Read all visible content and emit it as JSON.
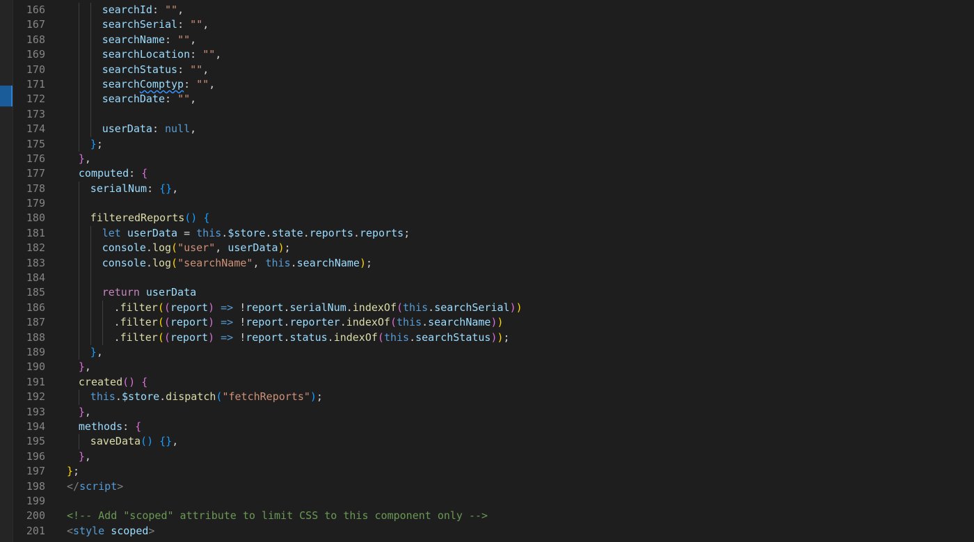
{
  "editor": {
    "colors": {
      "background": "#1e1e1e",
      "line_number": "#858585",
      "active_marker": "#1a5b99"
    },
    "lines": [
      {
        "num": "166",
        "guides": [
          1,
          2
        ],
        "tokens": [
          [
            "searchId",
            "prop"
          ],
          [
            ": ",
            ""
          ],
          [
            "\"\"",
            "str"
          ],
          [
            ",",
            ""
          ]
        ]
      },
      {
        "num": "167",
        "guides": [
          1,
          2
        ],
        "tokens": [
          [
            "searchSerial",
            "prop"
          ],
          [
            ": ",
            ""
          ],
          [
            "\"\"",
            "str"
          ],
          [
            ",",
            ""
          ]
        ]
      },
      {
        "num": "168",
        "guides": [
          1,
          2
        ],
        "tokens": [
          [
            "searchName",
            "prop"
          ],
          [
            ": ",
            ""
          ],
          [
            "\"\"",
            "str"
          ],
          [
            ",",
            ""
          ]
        ]
      },
      {
        "num": "169",
        "guides": [
          1,
          2
        ],
        "tokens": [
          [
            "searchLocation",
            "prop"
          ],
          [
            ": ",
            ""
          ],
          [
            "\"\"",
            "str"
          ],
          [
            ",",
            ""
          ]
        ]
      },
      {
        "num": "170",
        "guides": [
          1,
          2
        ],
        "tokens": [
          [
            "searchStatus",
            "prop"
          ],
          [
            ": ",
            ""
          ],
          [
            "\"\"",
            "str"
          ],
          [
            ",",
            ""
          ]
        ]
      },
      {
        "num": "171",
        "guides": [
          1,
          2
        ],
        "tokens": [
          [
            "search",
            "prop"
          ],
          [
            "Comptyp",
            "prop squiggle"
          ],
          [
            ": ",
            ""
          ],
          [
            "\"\"",
            "str"
          ],
          [
            ",",
            ""
          ]
        ]
      },
      {
        "num": "172",
        "guides": [
          1,
          2
        ],
        "tokens": [
          [
            "searchDate",
            "prop"
          ],
          [
            ": ",
            ""
          ],
          [
            "\"\"",
            "str"
          ],
          [
            ",",
            ""
          ]
        ]
      },
      {
        "num": "173",
        "guides": [
          1,
          2
        ],
        "tokens": []
      },
      {
        "num": "174",
        "guides": [
          1,
          2
        ],
        "tokens": [
          [
            "userData",
            "prop"
          ],
          [
            ": ",
            ""
          ],
          [
            "null",
            "kw"
          ],
          [
            ",",
            ""
          ]
        ]
      },
      {
        "num": "175",
        "guides": [
          1
        ],
        "indent": 2,
        "tokens": [
          [
            "}",
            "br3"
          ],
          [
            ";",
            ""
          ]
        ]
      },
      {
        "num": "176",
        "guides": [],
        "indent": 1,
        "tokens": [
          [
            "}",
            "br2"
          ],
          [
            ",",
            ""
          ]
        ]
      },
      {
        "num": "177",
        "guides": [],
        "indent": 1,
        "tokens": [
          [
            "computed",
            "prop"
          ],
          [
            ": ",
            ""
          ],
          [
            "{",
            "br2"
          ]
        ]
      },
      {
        "num": "178",
        "guides": [
          1
        ],
        "indent": 2,
        "tokens": [
          [
            "serialNum",
            "prop"
          ],
          [
            ": ",
            ""
          ],
          [
            "{}",
            "br3"
          ],
          [
            ",",
            ""
          ]
        ]
      },
      {
        "num": "179",
        "guides": [
          1
        ],
        "tokens": []
      },
      {
        "num": "180",
        "guides": [
          1
        ],
        "indent": 2,
        "tokens": [
          [
            "filteredReports",
            "fn"
          ],
          [
            "()",
            "br3"
          ],
          [
            " ",
            ""
          ],
          [
            "{",
            "br3"
          ]
        ]
      },
      {
        "num": "181",
        "guides": [
          1,
          2
        ],
        "tokens": [
          [
            "let",
            "kw"
          ],
          [
            " ",
            ""
          ],
          [
            "userData",
            "prop"
          ],
          [
            " = ",
            ""
          ],
          [
            "this",
            "kw"
          ],
          [
            ".",
            ""
          ],
          [
            "$store",
            "prop"
          ],
          [
            ".",
            ""
          ],
          [
            "state",
            "prop"
          ],
          [
            ".",
            ""
          ],
          [
            "reports",
            "prop"
          ],
          [
            ".",
            ""
          ],
          [
            "reports",
            "prop"
          ],
          [
            ";",
            ""
          ]
        ]
      },
      {
        "num": "182",
        "guides": [
          1,
          2
        ],
        "tokens": [
          [
            "console",
            "prop"
          ],
          [
            ".",
            ""
          ],
          [
            "log",
            "fn"
          ],
          [
            "(",
            "br1"
          ],
          [
            "\"user\"",
            "str"
          ],
          [
            ", ",
            ""
          ],
          [
            "userData",
            "prop"
          ],
          [
            ")",
            "br1"
          ],
          [
            ";",
            ""
          ]
        ]
      },
      {
        "num": "183",
        "guides": [
          1,
          2
        ],
        "tokens": [
          [
            "console",
            "prop"
          ],
          [
            ".",
            ""
          ],
          [
            "log",
            "fn"
          ],
          [
            "(",
            "br1"
          ],
          [
            "\"searchName\"",
            "str"
          ],
          [
            ", ",
            ""
          ],
          [
            "this",
            "kw"
          ],
          [
            ".",
            ""
          ],
          [
            "searchName",
            "prop"
          ],
          [
            ")",
            "br1"
          ],
          [
            ";",
            ""
          ]
        ]
      },
      {
        "num": "184",
        "guides": [
          1,
          2
        ],
        "tokens": []
      },
      {
        "num": "185",
        "guides": [
          1,
          2
        ],
        "tokens": [
          [
            "return",
            "ctrl"
          ],
          [
            " ",
            ""
          ],
          [
            "userData",
            "prop"
          ]
        ]
      },
      {
        "num": "186",
        "guides": [
          1,
          2,
          3
        ],
        "tokens": [
          [
            ".",
            ""
          ],
          [
            "filter",
            "fn"
          ],
          [
            "(",
            "br1"
          ],
          [
            "(",
            "br2"
          ],
          [
            "report",
            "prop"
          ],
          [
            ")",
            "br2"
          ],
          [
            " ",
            ""
          ],
          [
            "=>",
            "kw"
          ],
          [
            " !",
            ""
          ],
          [
            "report",
            "prop"
          ],
          [
            ".",
            ""
          ],
          [
            "serialNum",
            "prop"
          ],
          [
            ".",
            ""
          ],
          [
            "indexOf",
            "fn"
          ],
          [
            "(",
            "br2"
          ],
          [
            "this",
            "kw"
          ],
          [
            ".",
            ""
          ],
          [
            "searchSerial",
            "prop"
          ],
          [
            ")",
            "br2"
          ],
          [
            ")",
            "br1"
          ]
        ]
      },
      {
        "num": "187",
        "guides": [
          1,
          2,
          3
        ],
        "tokens": [
          [
            ".",
            ""
          ],
          [
            "filter",
            "fn"
          ],
          [
            "(",
            "br1"
          ],
          [
            "(",
            "br2"
          ],
          [
            "report",
            "prop"
          ],
          [
            ")",
            "br2"
          ],
          [
            " ",
            ""
          ],
          [
            "=>",
            "kw"
          ],
          [
            " !",
            ""
          ],
          [
            "report",
            "prop"
          ],
          [
            ".",
            ""
          ],
          [
            "reporter",
            "prop"
          ],
          [
            ".",
            ""
          ],
          [
            "indexOf",
            "fn"
          ],
          [
            "(",
            "br2"
          ],
          [
            "this",
            "kw"
          ],
          [
            ".",
            ""
          ],
          [
            "searchName",
            "prop"
          ],
          [
            ")",
            "br2"
          ],
          [
            ")",
            "br1"
          ]
        ]
      },
      {
        "num": "188",
        "guides": [
          1,
          2,
          3
        ],
        "tokens": [
          [
            ".",
            ""
          ],
          [
            "filter",
            "fn"
          ],
          [
            "(",
            "br1"
          ],
          [
            "(",
            "br2"
          ],
          [
            "report",
            "prop"
          ],
          [
            ")",
            "br2"
          ],
          [
            " ",
            ""
          ],
          [
            "=>",
            "kw"
          ],
          [
            " !",
            ""
          ],
          [
            "report",
            "prop"
          ],
          [
            ".",
            ""
          ],
          [
            "status",
            "prop"
          ],
          [
            ".",
            ""
          ],
          [
            "indexOf",
            "fn"
          ],
          [
            "(",
            "br2"
          ],
          [
            "this",
            "kw"
          ],
          [
            ".",
            ""
          ],
          [
            "searchStatus",
            "prop"
          ],
          [
            ")",
            "br2"
          ],
          [
            ")",
            "br1"
          ],
          [
            ";",
            ""
          ]
        ]
      },
      {
        "num": "189",
        "guides": [
          1
        ],
        "indent": 2,
        "tokens": [
          [
            "}",
            "br3"
          ],
          [
            ",",
            ""
          ]
        ]
      },
      {
        "num": "190",
        "guides": [],
        "indent": 1,
        "tokens": [
          [
            "}",
            "br2"
          ],
          [
            ",",
            ""
          ]
        ]
      },
      {
        "num": "191",
        "guides": [],
        "indent": 1,
        "tokens": [
          [
            "created",
            "fn"
          ],
          [
            "()",
            "br2"
          ],
          [
            " ",
            ""
          ],
          [
            "{",
            "br2"
          ]
        ]
      },
      {
        "num": "192",
        "guides": [
          1
        ],
        "indent": 2,
        "tokens": [
          [
            "this",
            "kw"
          ],
          [
            ".",
            ""
          ],
          [
            "$store",
            "prop"
          ],
          [
            ".",
            ""
          ],
          [
            "dispatch",
            "fn"
          ],
          [
            "(",
            "br3"
          ],
          [
            "\"fetchReports\"",
            "str"
          ],
          [
            ")",
            "br3"
          ],
          [
            ";",
            ""
          ]
        ]
      },
      {
        "num": "193",
        "guides": [],
        "indent": 1,
        "tokens": [
          [
            "}",
            "br2"
          ],
          [
            ",",
            ""
          ]
        ]
      },
      {
        "num": "194",
        "guides": [],
        "indent": 1,
        "tokens": [
          [
            "methods",
            "prop"
          ],
          [
            ": ",
            ""
          ],
          [
            "{",
            "br2"
          ]
        ]
      },
      {
        "num": "195",
        "guides": [
          1
        ],
        "indent": 2,
        "tokens": [
          [
            "saveData",
            "fn"
          ],
          [
            "()",
            "br3"
          ],
          [
            " ",
            ""
          ],
          [
            "{}",
            "br3"
          ],
          [
            ",",
            ""
          ]
        ]
      },
      {
        "num": "196",
        "guides": [],
        "indent": 1,
        "tokens": [
          [
            "}",
            "br2"
          ],
          [
            ",",
            ""
          ]
        ]
      },
      {
        "num": "197",
        "guides": [],
        "indent": 0,
        "tokens": [
          [
            "}",
            "br1"
          ],
          [
            ";",
            ""
          ]
        ]
      },
      {
        "num": "198",
        "guides": [],
        "indent": 0,
        "tokens": [
          [
            "</",
            "tagpunc"
          ],
          [
            "script",
            "tag"
          ],
          [
            ">",
            "tagpunc"
          ]
        ]
      },
      {
        "num": "199",
        "guides": [],
        "indent": 0,
        "tokens": []
      },
      {
        "num": "200",
        "guides": [],
        "indent": 0,
        "tokens": [
          [
            "<!-- Add \"scoped\" attribute to limit CSS to this component only -->",
            "cmt"
          ]
        ]
      },
      {
        "num": "201",
        "guides": [],
        "indent": 0,
        "tokens": [
          [
            "<",
            "tagpunc"
          ],
          [
            "style",
            "tag"
          ],
          [
            " ",
            ""
          ],
          [
            "scoped",
            "attr"
          ],
          [
            ">",
            "tagpunc"
          ]
        ]
      }
    ]
  }
}
